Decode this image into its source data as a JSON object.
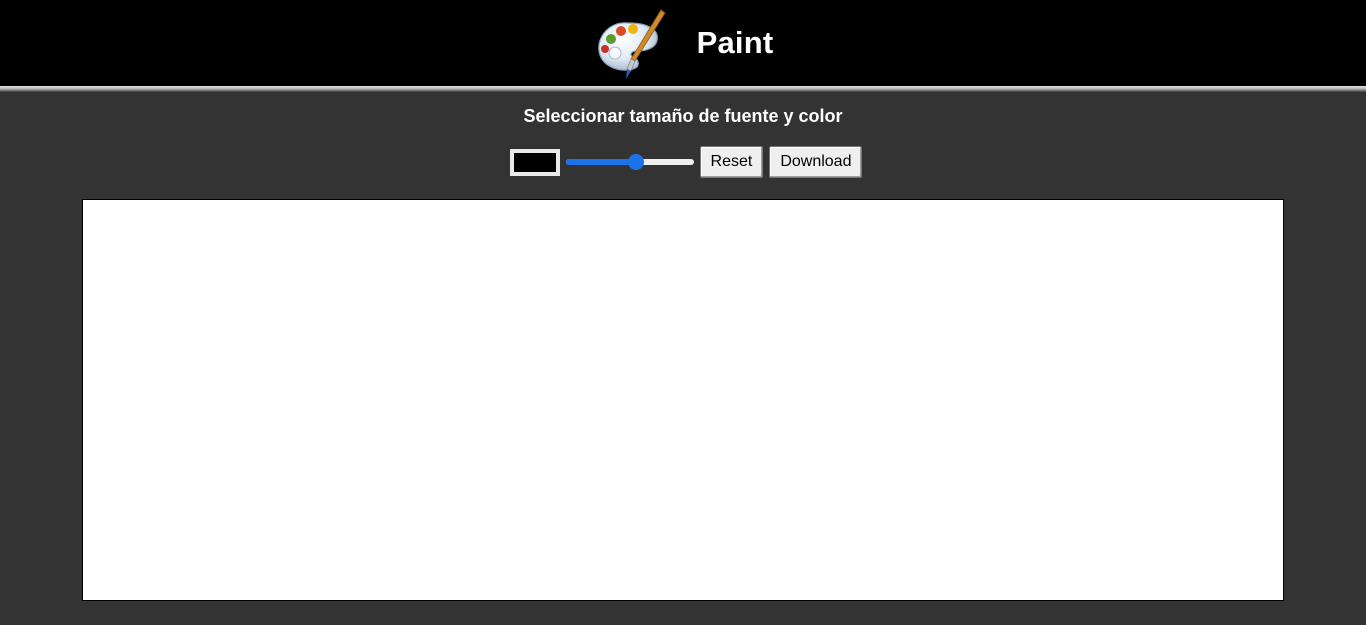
{
  "header": {
    "logo_icon": "paint-palette-icon",
    "title": "Paint",
    "background_color": "#000000"
  },
  "toolbar": {
    "subtitle": "Seleccionar tamaño de fuente y color",
    "color_picker": {
      "value": "#000000"
    },
    "brush_size": {
      "fraction": 0.55
    },
    "reset_label": "Reset",
    "download_label": "Download",
    "accent_color": "#1a73e8"
  },
  "canvas": {
    "background_color": "#ffffff"
  },
  "page": {
    "background_color": "#333333"
  }
}
